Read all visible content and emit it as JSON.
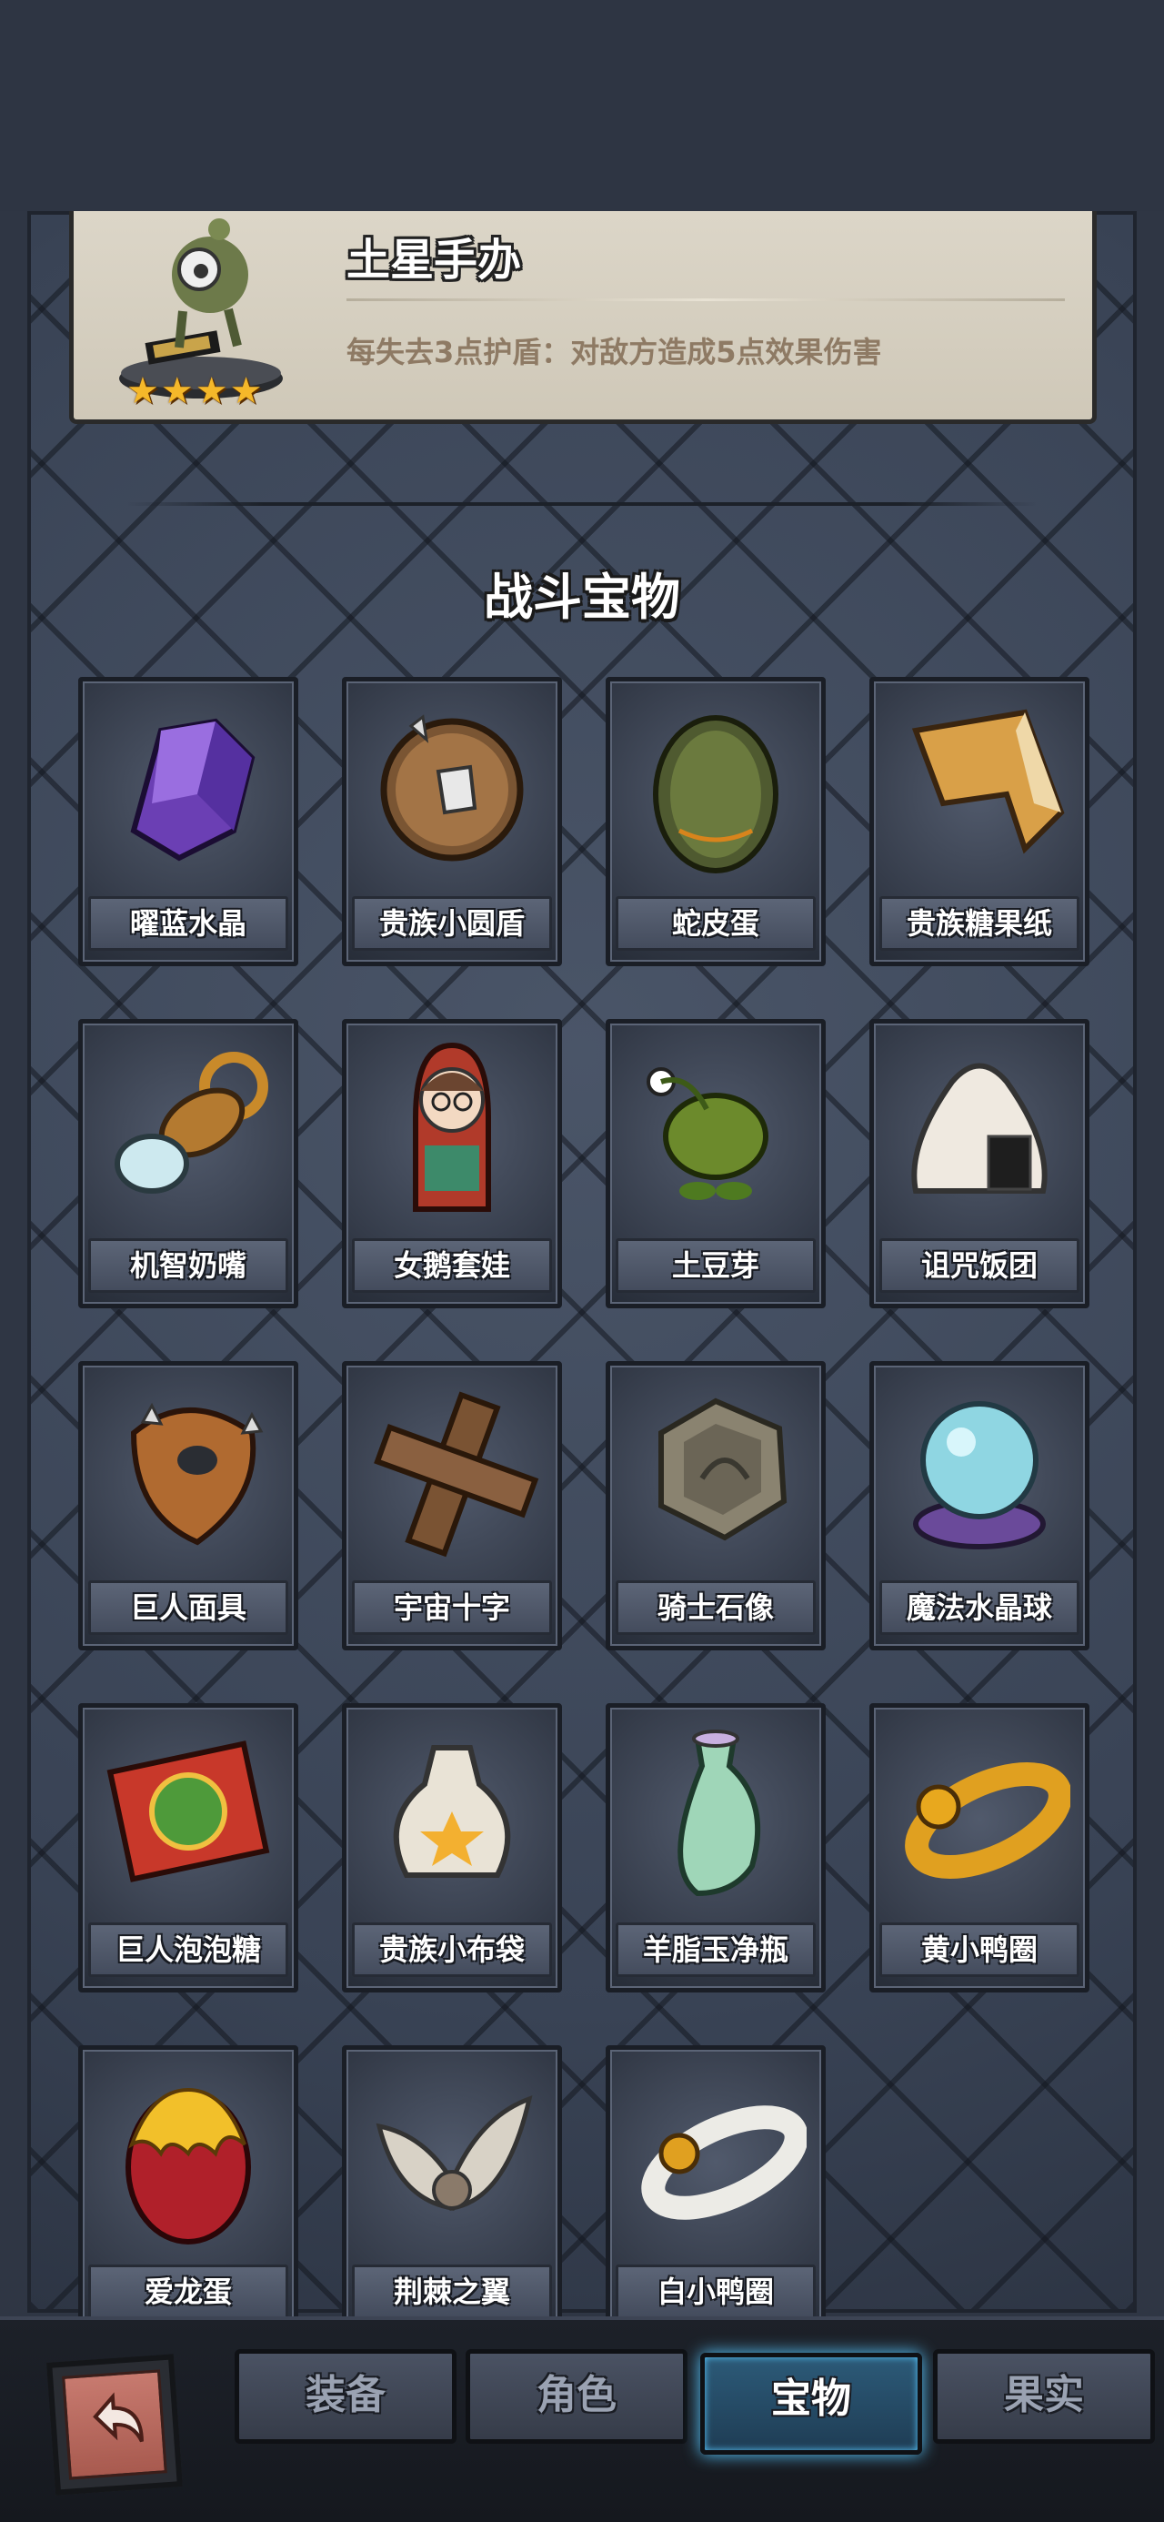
{
  "detail": {
    "name": "土星手办",
    "description": "每失去3点护盾：对敌方造成5点效果伤害",
    "stars": [
      "★",
      "★",
      "★",
      "★"
    ]
  },
  "section": {
    "title": "战斗宝物"
  },
  "treasures": [
    {
      "label": "曜蓝水晶",
      "icon": "purple-crystal-icon"
    },
    {
      "label": "贵族小圆盾",
      "icon": "round-shield-icon"
    },
    {
      "label": "蛇皮蛋",
      "icon": "snakeskin-egg-icon"
    },
    {
      "label": "贵族糖果纸",
      "icon": "candy-wrapper-icon"
    },
    {
      "label": "机智奶嘴",
      "icon": "pacifier-icon"
    },
    {
      "label": "女鹅套娃",
      "icon": "nesting-doll-icon"
    },
    {
      "label": "土豆芽",
      "icon": "potato-sprout-icon"
    },
    {
      "label": "诅咒饭团",
      "icon": "rice-ball-icon"
    },
    {
      "label": "巨人面具",
      "icon": "giant-mask-icon"
    },
    {
      "label": "宇宙十字",
      "icon": "wooden-cross-icon"
    },
    {
      "label": "骑士石像",
      "icon": "stone-statue-icon"
    },
    {
      "label": "魔法水晶球",
      "icon": "crystal-ball-icon"
    },
    {
      "label": "巨人泡泡糖",
      "icon": "bubble-gum-icon"
    },
    {
      "label": "贵族小布袋",
      "icon": "cloth-bag-icon"
    },
    {
      "label": "羊脂玉净瓶",
      "icon": "jade-vase-icon"
    },
    {
      "label": "黄小鸭圈",
      "icon": "yellow-duck-ring-icon"
    },
    {
      "label": "爱龙蛋",
      "icon": "dragon-egg-icon"
    },
    {
      "label": "荆棘之翼",
      "icon": "thorn-wings-icon"
    },
    {
      "label": "白小鸭圈",
      "icon": "white-duck-ring-icon"
    }
  ],
  "tabs": [
    {
      "label": "装备",
      "active": false
    },
    {
      "label": "角色",
      "active": false
    },
    {
      "label": "宝物",
      "active": true
    },
    {
      "label": "果实",
      "active": false
    }
  ],
  "back_button": {
    "icon": "back-arrow-icon"
  }
}
